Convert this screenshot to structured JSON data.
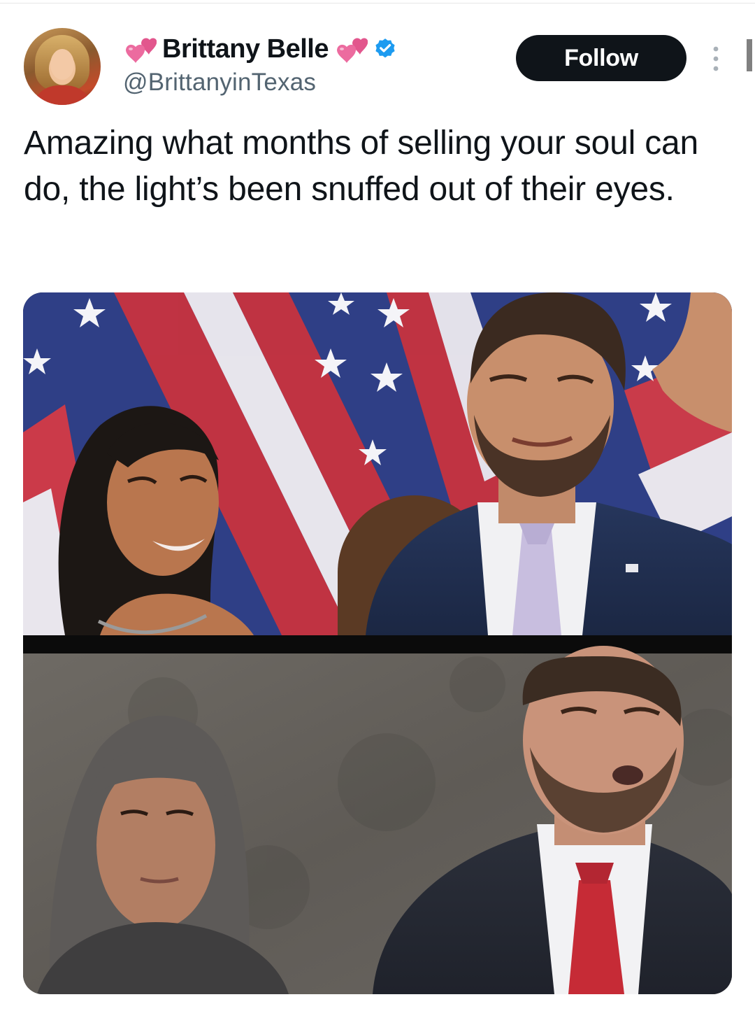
{
  "post": {
    "author": {
      "display_name": "Brittany Belle",
      "handle": "@BrittanyinTexas",
      "verified": true,
      "name_emoji": "two-hearts-icon"
    },
    "follow_label": "Follow",
    "text": "Amazing what months of selling your soul can do, the light’s been snuffed out of their eyes.",
    "media": {
      "type": "image-collage",
      "panels": 2
    }
  },
  "colors": {
    "follow_bg": "#0f1419",
    "verified_blue": "#1d9bf0",
    "heart_pink": "#e2568d",
    "handle_gray": "#536471"
  }
}
